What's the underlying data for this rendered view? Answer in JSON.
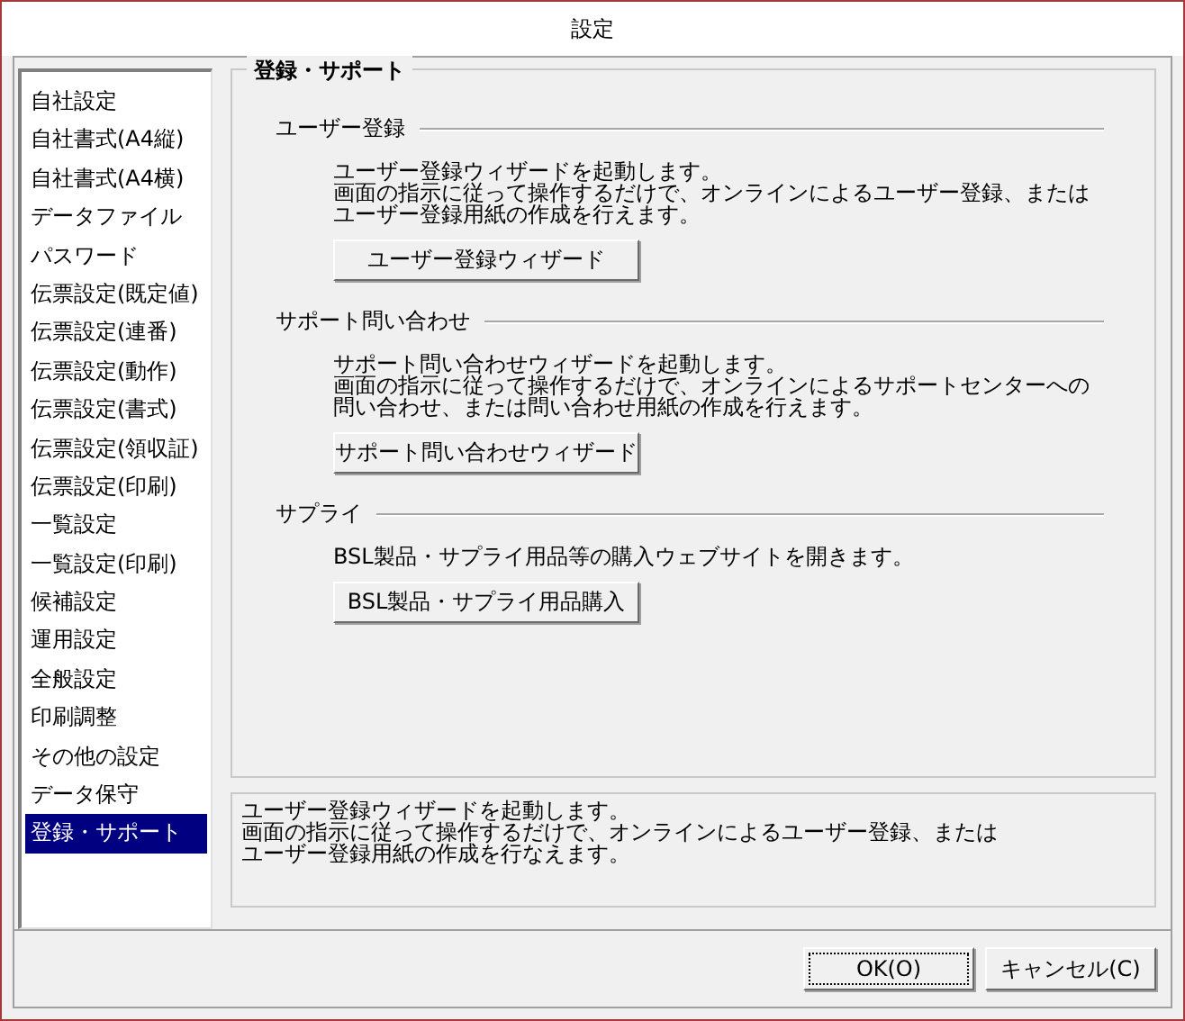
{
  "window": {
    "title": "設定"
  },
  "sidebar": {
    "items": [
      {
        "label": "自社設定",
        "selected": false
      },
      {
        "label": "自社書式(A4縦)",
        "selected": false
      },
      {
        "label": "自社書式(A4横)",
        "selected": false
      },
      {
        "label": "データファイル",
        "selected": false
      },
      {
        "label": "パスワード",
        "selected": false
      },
      {
        "label": "伝票設定(既定値)",
        "selected": false
      },
      {
        "label": "伝票設定(連番)",
        "selected": false
      },
      {
        "label": "伝票設定(動作)",
        "selected": false
      },
      {
        "label": "伝票設定(書式)",
        "selected": false
      },
      {
        "label": "伝票設定(領収証)",
        "selected": false
      },
      {
        "label": "伝票設定(印刷)",
        "selected": false
      },
      {
        "label": "一覧設定",
        "selected": false
      },
      {
        "label": "一覧設定(印刷)",
        "selected": false
      },
      {
        "label": "候補設定",
        "selected": false
      },
      {
        "label": "運用設定",
        "selected": false
      },
      {
        "label": "全般設定",
        "selected": false
      },
      {
        "label": "印刷調整",
        "selected": false
      },
      {
        "label": "その他の設定",
        "selected": false
      },
      {
        "label": "データ保守",
        "selected": false
      },
      {
        "label": "登録・サポート",
        "selected": true
      }
    ]
  },
  "panel": {
    "title": "登録・サポート",
    "sections": [
      {
        "heading": "ユーザー登録",
        "description": [
          "ユーザー登録ウィザードを起動します。",
          "画面の指示に従って操作するだけで、オンラインによるユーザー登録、または",
          "ユーザー登録用紙の作成を行えます。"
        ],
        "button": "ユーザー登録ウィザード"
      },
      {
        "heading": "サポート問い合わせ",
        "description": [
          "サポート問い合わせウィザードを起動します。",
          "画面の指示に従って操作するだけで、オンラインによるサポートセンターへの",
          "問い合わせ、または問い合わせ用紙の作成を行えます。"
        ],
        "button": "サポート問い合わせウィザード"
      },
      {
        "heading": "サプライ",
        "description": [
          "BSL製品・サプライ用品等の購入ウェブサイトを開きます。"
        ],
        "button": "BSL製品・サプライ用品購入"
      }
    ]
  },
  "help_box": {
    "lines": [
      "ユーザー登録ウィザードを起動します。",
      "画面の指示に従って操作するだけで、オンラインによるユーザー登録、または",
      "ユーザー登録用紙の作成を行なえます。"
    ]
  },
  "buttons": [
    {
      "label": "OK(O)",
      "focused": true
    },
    {
      "label": "キャンセル(C)",
      "focused": false
    }
  ]
}
